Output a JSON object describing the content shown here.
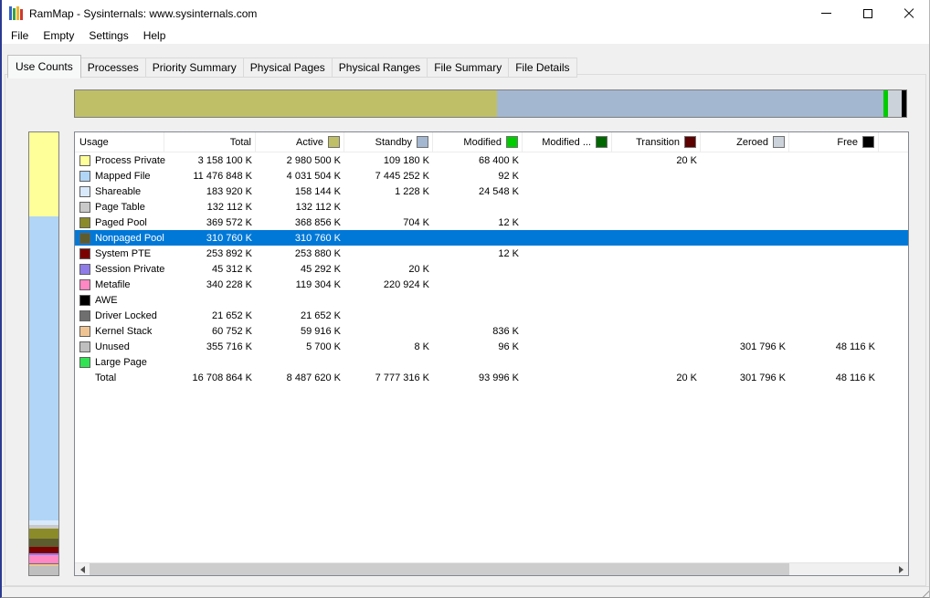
{
  "window": {
    "title": "RamMap - Sysinternals: www.sysinternals.com"
  },
  "menu": {
    "items": [
      "File",
      "Empty",
      "Settings",
      "Help"
    ]
  },
  "tabs": {
    "items": [
      "Use Counts",
      "Processes",
      "Priority Summary",
      "Physical Pages",
      "Physical Ranges",
      "File Summary",
      "File Details"
    ],
    "active": "Use Counts"
  },
  "top_bar": {
    "segments": [
      {
        "name": "active",
        "color": "#bfbf68",
        "pct": 50.8
      },
      {
        "name": "standby",
        "color": "#a3b7d0",
        "pct": 46.4
      },
      {
        "name": "modified",
        "color": "#00cc00",
        "pct": 0.6
      },
      {
        "name": "zeroed",
        "color": "#ccd2da",
        "pct": 1.7
      },
      {
        "name": "free",
        "color": "#000000",
        "pct": 0.5
      }
    ]
  },
  "left_bar": {
    "segments": [
      {
        "name": "process-private",
        "color": "#ffff99",
        "pct": 18.9
      },
      {
        "name": "mapped-file",
        "color": "#b1d5f6",
        "pct": 68.7
      },
      {
        "name": "shareable",
        "color": "#d8e9fb",
        "pct": 1.1
      },
      {
        "name": "page-table",
        "color": "#c9c9c9",
        "pct": 0.8
      },
      {
        "name": "paged-pool",
        "color": "#8b8b2a",
        "pct": 2.2
      },
      {
        "name": "nonpaged-pool",
        "color": "#5c5c2e",
        "pct": 1.9
      },
      {
        "name": "system-pte",
        "color": "#7b0000",
        "pct": 1.5
      },
      {
        "name": "session-private",
        "color": "#8f7ce8",
        "pct": 0.3
      },
      {
        "name": "metafile",
        "color": "#ff87c3",
        "pct": 2.0
      },
      {
        "name": "driver-locked",
        "color": "#6f6f6f",
        "pct": 0.15
      },
      {
        "name": "kernel-stack",
        "color": "#f0c492",
        "pct": 0.35
      },
      {
        "name": "unused",
        "color": "#bfbfbf",
        "pct": 2.1
      }
    ]
  },
  "table": {
    "columns": [
      {
        "key": "usage",
        "label": "Usage",
        "swatch": null
      },
      {
        "key": "total",
        "label": "Total",
        "swatch": null
      },
      {
        "key": "active",
        "label": "Active",
        "swatch": "#bfbf68"
      },
      {
        "key": "standby",
        "label": "Standby",
        "swatch": "#a3b7d0"
      },
      {
        "key": "modified",
        "label": "Modified",
        "swatch": "#00cc00"
      },
      {
        "key": "modified-no-write",
        "label": "Modified ...",
        "swatch": "#006600"
      },
      {
        "key": "transition",
        "label": "Transition",
        "swatch": "#5c0000"
      },
      {
        "key": "zeroed",
        "label": "Zeroed",
        "swatch": "#ccd2da"
      },
      {
        "key": "free",
        "label": "Free",
        "swatch": "#000000"
      }
    ],
    "rows": [
      {
        "usage": "Process Private",
        "swatch": "#ffff99",
        "selected": false,
        "values": [
          "3 158 100 K",
          "2 980 500 K",
          "109 180 K",
          "68 400 K",
          "",
          "20 K",
          "",
          ""
        ]
      },
      {
        "usage": "Mapped File",
        "swatch": "#b1d5f6",
        "selected": false,
        "values": [
          "11 476 848 K",
          "4 031 504 K",
          "7 445 252 K",
          "92 K",
          "",
          "",
          "",
          ""
        ]
      },
      {
        "usage": "Shareable",
        "swatch": "#d8e9fb",
        "selected": false,
        "values": [
          "183 920 K",
          "158 144 K",
          "1 228 K",
          "24 548 K",
          "",
          "",
          "",
          ""
        ]
      },
      {
        "usage": "Page Table",
        "swatch": "#c9c9c9",
        "selected": false,
        "values": [
          "132 112 K",
          "132 112 K",
          "",
          "",
          "",
          "",
          "",
          ""
        ]
      },
      {
        "usage": "Paged Pool",
        "swatch": "#8b8b2a",
        "selected": false,
        "values": [
          "369 572 K",
          "368 856 K",
          "704 K",
          "12 K",
          "",
          "",
          "",
          ""
        ]
      },
      {
        "usage": "Nonpaged Pool",
        "swatch": "#5c5c2e",
        "selected": true,
        "values": [
          "310 760 K",
          "310 760 K",
          "",
          "",
          "",
          "",
          "",
          ""
        ]
      },
      {
        "usage": "System PTE",
        "swatch": "#7b0000",
        "selected": false,
        "values": [
          "253 892 K",
          "253 880 K",
          "",
          "12 K",
          "",
          "",
          "",
          ""
        ]
      },
      {
        "usage": "Session Private",
        "swatch": "#8f7ce8",
        "selected": false,
        "values": [
          "45 312 K",
          "45 292 K",
          "20 K",
          "",
          "",
          "",
          "",
          ""
        ]
      },
      {
        "usage": "Metafile",
        "swatch": "#ff87c3",
        "selected": false,
        "values": [
          "340 228 K",
          "119 304 K",
          "220 924 K",
          "",
          "",
          "",
          "",
          ""
        ]
      },
      {
        "usage": "AWE",
        "swatch": "#000000",
        "selected": false,
        "values": [
          "",
          "",
          "",
          "",
          "",
          "",
          "",
          ""
        ]
      },
      {
        "usage": "Driver Locked",
        "swatch": "#6f6f6f",
        "selected": false,
        "values": [
          "21 652 K",
          "21 652 K",
          "",
          "",
          "",
          "",
          "",
          ""
        ]
      },
      {
        "usage": "Kernel Stack",
        "swatch": "#f0c492",
        "selected": false,
        "values": [
          "60 752 K",
          "59 916 K",
          "",
          "836 K",
          "",
          "",
          "",
          ""
        ]
      },
      {
        "usage": "Unused",
        "swatch": "#bfbfbf",
        "selected": false,
        "values": [
          "355 716 K",
          "5 700 K",
          "8 K",
          "96 K",
          "",
          "",
          "301 796 K",
          "48 116 K"
        ]
      },
      {
        "usage": "Large Page",
        "swatch": "#2fe353",
        "selected": false,
        "values": [
          "",
          "",
          "",
          "",
          "",
          "",
          "",
          ""
        ]
      },
      {
        "usage": "Total",
        "swatch": null,
        "selected": false,
        "values": [
          "16 708 864 K",
          "8 487 620 K",
          "7 777 316 K",
          "93 996 K",
          "",
          "20 K",
          "301 796 K",
          "48 116 K"
        ]
      }
    ]
  }
}
